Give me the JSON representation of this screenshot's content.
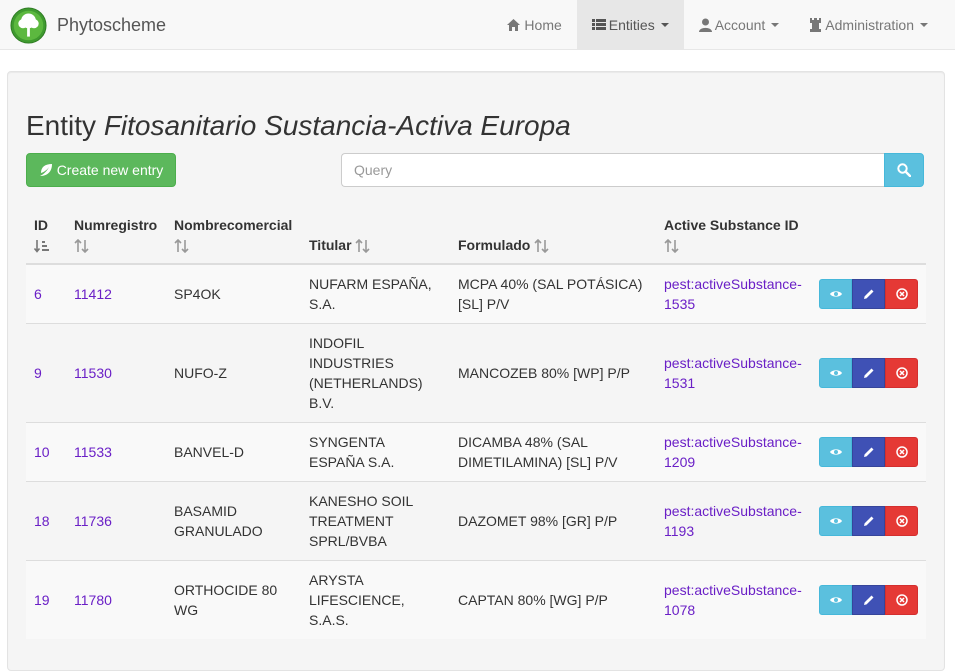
{
  "brand": {
    "name": "Phytoscheme"
  },
  "nav": [
    {
      "label": "Home",
      "icon": "home-icon",
      "active": false,
      "dropdown": false
    },
    {
      "label": "Entities",
      "icon": "list-icon",
      "active": true,
      "dropdown": true
    },
    {
      "label": "Account",
      "icon": "user-icon",
      "active": false,
      "dropdown": true
    },
    {
      "label": "Administration",
      "icon": "tower-icon",
      "active": false,
      "dropdown": true
    }
  ],
  "page": {
    "title_prefix": "Entity",
    "title_entity": "Fitosanitario Sustancia-Activa Europa",
    "create_label": "Create new entry",
    "search_placeholder": "Query"
  },
  "table": {
    "headers": [
      "ID",
      "Numregistro",
      "Nombrecomercial",
      "Titular",
      "Formulado",
      "Active Substance ID"
    ],
    "rows": [
      {
        "id": "6",
        "numregistro": "11412",
        "nombrecomercial": "SP4OK",
        "titular": "NUFARM ESPAÑA, S.A.",
        "formulado": "MCPA 40% (SAL POTÁSICA) [SL] P/V",
        "active_substance": "pest:activeSubstance-1535"
      },
      {
        "id": "9",
        "numregistro": "11530",
        "nombrecomercial": "NUFO-Z",
        "titular": "INDOFIL INDUSTRIES (NETHERLANDS) B.V.",
        "formulado": "MANCOZEB 80% [WP] P/P",
        "active_substance": "pest:activeSubstance-1531"
      },
      {
        "id": "10",
        "numregistro": "11533",
        "nombrecomercial": "BANVEL-D",
        "titular": "SYNGENTA ESPAÑA S.A.",
        "formulado": "DICAMBA 48% (SAL DIMETILAMINA) [SL] P/V",
        "active_substance": "pest:activeSubstance-1209"
      },
      {
        "id": "18",
        "numregistro": "11736",
        "nombrecomercial": "BASAMID GRANULADO",
        "titular": "KANESHO SOIL TREATMENT SPRL/BVBA",
        "formulado": "DAZOMET 98% [GR] P/P",
        "active_substance": "pest:activeSubstance-1193"
      },
      {
        "id": "19",
        "numregistro": "11780",
        "nombrecomercial": "ORTHOCIDE 80 WG",
        "titular": "ARYSTA LIFESCIENCE, S.A.S.",
        "formulado": "CAPTAN 80% [WG] P/P",
        "active_substance": "pest:activeSubstance-1078"
      }
    ]
  },
  "colors": {
    "link": "#6a1fc6",
    "create_button": "#5cb85c",
    "view_button": "#5bc0de",
    "edit_button": "#3f51b5",
    "delete_button": "#e53935"
  }
}
